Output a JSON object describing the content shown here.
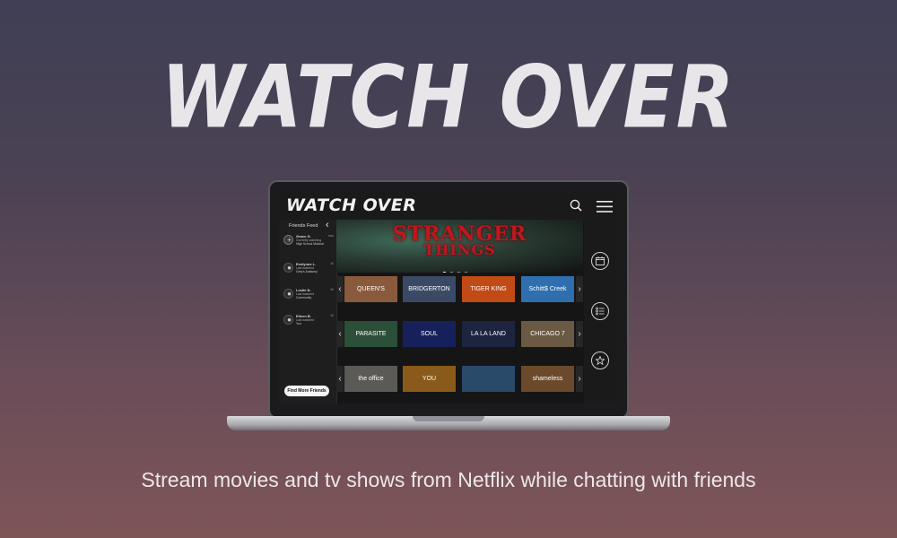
{
  "hero": {
    "title": "WATCH OVER",
    "tagline": "Stream movies and tv shows from Netflix while chatting with friends"
  },
  "app": {
    "brand": "WATCH OVER",
    "sidebar": {
      "title": "Friends Feed",
      "friends": [
        {
          "name": "Grace G.",
          "status": "Currently watching",
          "show": "High School Musical",
          "time": "now"
        },
        {
          "name": "Evelynne L.",
          "status": "Last watched",
          "show": "Grey's Anatomy",
          "time": "1h"
        },
        {
          "name": "Leslie N.",
          "status": "Last watched",
          "show": "Community",
          "time": "4h"
        },
        {
          "name": "Eileen B.",
          "status": "Last watched",
          "show": "You",
          "time": "1h"
        }
      ],
      "find_button": "Find More Friends"
    },
    "banner": {
      "title_line1": "STRANGER",
      "title_line2": "THINGS",
      "dot_count": 4,
      "active_dot": 1
    },
    "rows": [
      {
        "tiles": [
          {
            "label": "QUEEN'S GAMBIT",
            "color": "#8a5a3c"
          },
          {
            "label": "BRIDGERTON",
            "color": "#3a4a66"
          },
          {
            "label": "TIGER KING",
            "color": "#c24a14"
          },
          {
            "label": "Schitt$ Creek",
            "color": "#2f6fb0"
          }
        ]
      },
      {
        "tiles": [
          {
            "label": "PARASITE",
            "color": "#2b4f38"
          },
          {
            "label": "SOUL",
            "color": "#16205a"
          },
          {
            "label": "LA LA LAND",
            "color": "#1c2440"
          },
          {
            "label": "CHICAGO 7",
            "color": "#6a5a44"
          }
        ]
      },
      {
        "tiles": [
          {
            "label": "the office",
            "color": "#5c5a56"
          },
          {
            "label": "YOU",
            "color": "#8a5a1a"
          },
          {
            "label": "",
            "color": "#2a4a6a"
          },
          {
            "label": "shameless",
            "color": "#6a4a2a"
          }
        ]
      }
    ],
    "rail_icons": [
      "calendar-icon",
      "list-icon",
      "star-icon"
    ]
  }
}
